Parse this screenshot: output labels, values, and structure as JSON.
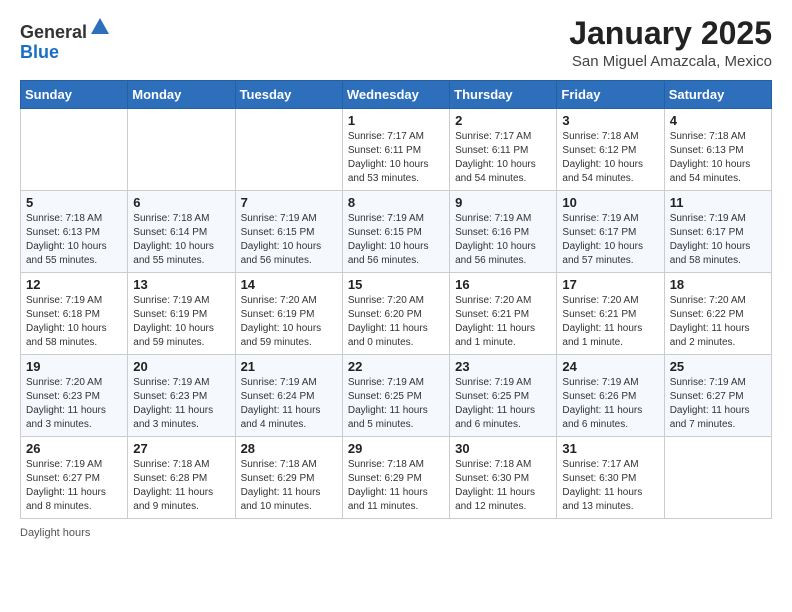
{
  "header": {
    "logo_general": "General",
    "logo_blue": "Blue",
    "month": "January 2025",
    "location": "San Miguel Amazcala, Mexico"
  },
  "weekdays": [
    "Sunday",
    "Monday",
    "Tuesday",
    "Wednesday",
    "Thursday",
    "Friday",
    "Saturday"
  ],
  "weeks": [
    [
      {
        "day": "",
        "sunrise": "",
        "sunset": "",
        "daylight": ""
      },
      {
        "day": "",
        "sunrise": "",
        "sunset": "",
        "daylight": ""
      },
      {
        "day": "",
        "sunrise": "",
        "sunset": "",
        "daylight": ""
      },
      {
        "day": "1",
        "sunrise": "7:17 AM",
        "sunset": "6:11 PM",
        "daylight": "10 hours and 53 minutes."
      },
      {
        "day": "2",
        "sunrise": "7:17 AM",
        "sunset": "6:11 PM",
        "daylight": "10 hours and 54 minutes."
      },
      {
        "day": "3",
        "sunrise": "7:18 AM",
        "sunset": "6:12 PM",
        "daylight": "10 hours and 54 minutes."
      },
      {
        "day": "4",
        "sunrise": "7:18 AM",
        "sunset": "6:13 PM",
        "daylight": "10 hours and 54 minutes."
      }
    ],
    [
      {
        "day": "5",
        "sunrise": "7:18 AM",
        "sunset": "6:13 PM",
        "daylight": "10 hours and 55 minutes."
      },
      {
        "day": "6",
        "sunrise": "7:18 AM",
        "sunset": "6:14 PM",
        "daylight": "10 hours and 55 minutes."
      },
      {
        "day": "7",
        "sunrise": "7:19 AM",
        "sunset": "6:15 PM",
        "daylight": "10 hours and 56 minutes."
      },
      {
        "day": "8",
        "sunrise": "7:19 AM",
        "sunset": "6:15 PM",
        "daylight": "10 hours and 56 minutes."
      },
      {
        "day": "9",
        "sunrise": "7:19 AM",
        "sunset": "6:16 PM",
        "daylight": "10 hours and 56 minutes."
      },
      {
        "day": "10",
        "sunrise": "7:19 AM",
        "sunset": "6:17 PM",
        "daylight": "10 hours and 57 minutes."
      },
      {
        "day": "11",
        "sunrise": "7:19 AM",
        "sunset": "6:17 PM",
        "daylight": "10 hours and 58 minutes."
      }
    ],
    [
      {
        "day": "12",
        "sunrise": "7:19 AM",
        "sunset": "6:18 PM",
        "daylight": "10 hours and 58 minutes."
      },
      {
        "day": "13",
        "sunrise": "7:19 AM",
        "sunset": "6:19 PM",
        "daylight": "10 hours and 59 minutes."
      },
      {
        "day": "14",
        "sunrise": "7:20 AM",
        "sunset": "6:19 PM",
        "daylight": "10 hours and 59 minutes."
      },
      {
        "day": "15",
        "sunrise": "7:20 AM",
        "sunset": "6:20 PM",
        "daylight": "11 hours and 0 minutes."
      },
      {
        "day": "16",
        "sunrise": "7:20 AM",
        "sunset": "6:21 PM",
        "daylight": "11 hours and 1 minute."
      },
      {
        "day": "17",
        "sunrise": "7:20 AM",
        "sunset": "6:21 PM",
        "daylight": "11 hours and 1 minute."
      },
      {
        "day": "18",
        "sunrise": "7:20 AM",
        "sunset": "6:22 PM",
        "daylight": "11 hours and 2 minutes."
      }
    ],
    [
      {
        "day": "19",
        "sunrise": "7:20 AM",
        "sunset": "6:23 PM",
        "daylight": "11 hours and 3 minutes."
      },
      {
        "day": "20",
        "sunrise": "7:19 AM",
        "sunset": "6:23 PM",
        "daylight": "11 hours and 3 minutes."
      },
      {
        "day": "21",
        "sunrise": "7:19 AM",
        "sunset": "6:24 PM",
        "daylight": "11 hours and 4 minutes."
      },
      {
        "day": "22",
        "sunrise": "7:19 AM",
        "sunset": "6:25 PM",
        "daylight": "11 hours and 5 minutes."
      },
      {
        "day": "23",
        "sunrise": "7:19 AM",
        "sunset": "6:25 PM",
        "daylight": "11 hours and 6 minutes."
      },
      {
        "day": "24",
        "sunrise": "7:19 AM",
        "sunset": "6:26 PM",
        "daylight": "11 hours and 6 minutes."
      },
      {
        "day": "25",
        "sunrise": "7:19 AM",
        "sunset": "6:27 PM",
        "daylight": "11 hours and 7 minutes."
      }
    ],
    [
      {
        "day": "26",
        "sunrise": "7:19 AM",
        "sunset": "6:27 PM",
        "daylight": "11 hours and 8 minutes."
      },
      {
        "day": "27",
        "sunrise": "7:18 AM",
        "sunset": "6:28 PM",
        "daylight": "11 hours and 9 minutes."
      },
      {
        "day": "28",
        "sunrise": "7:18 AM",
        "sunset": "6:29 PM",
        "daylight": "11 hours and 10 minutes."
      },
      {
        "day": "29",
        "sunrise": "7:18 AM",
        "sunset": "6:29 PM",
        "daylight": "11 hours and 11 minutes."
      },
      {
        "day": "30",
        "sunrise": "7:18 AM",
        "sunset": "6:30 PM",
        "daylight": "11 hours and 12 minutes."
      },
      {
        "day": "31",
        "sunrise": "7:17 AM",
        "sunset": "6:30 PM",
        "daylight": "11 hours and 13 minutes."
      },
      {
        "day": "",
        "sunrise": "",
        "sunset": "",
        "daylight": ""
      }
    ]
  ],
  "footer": {
    "note": "Daylight hours"
  }
}
